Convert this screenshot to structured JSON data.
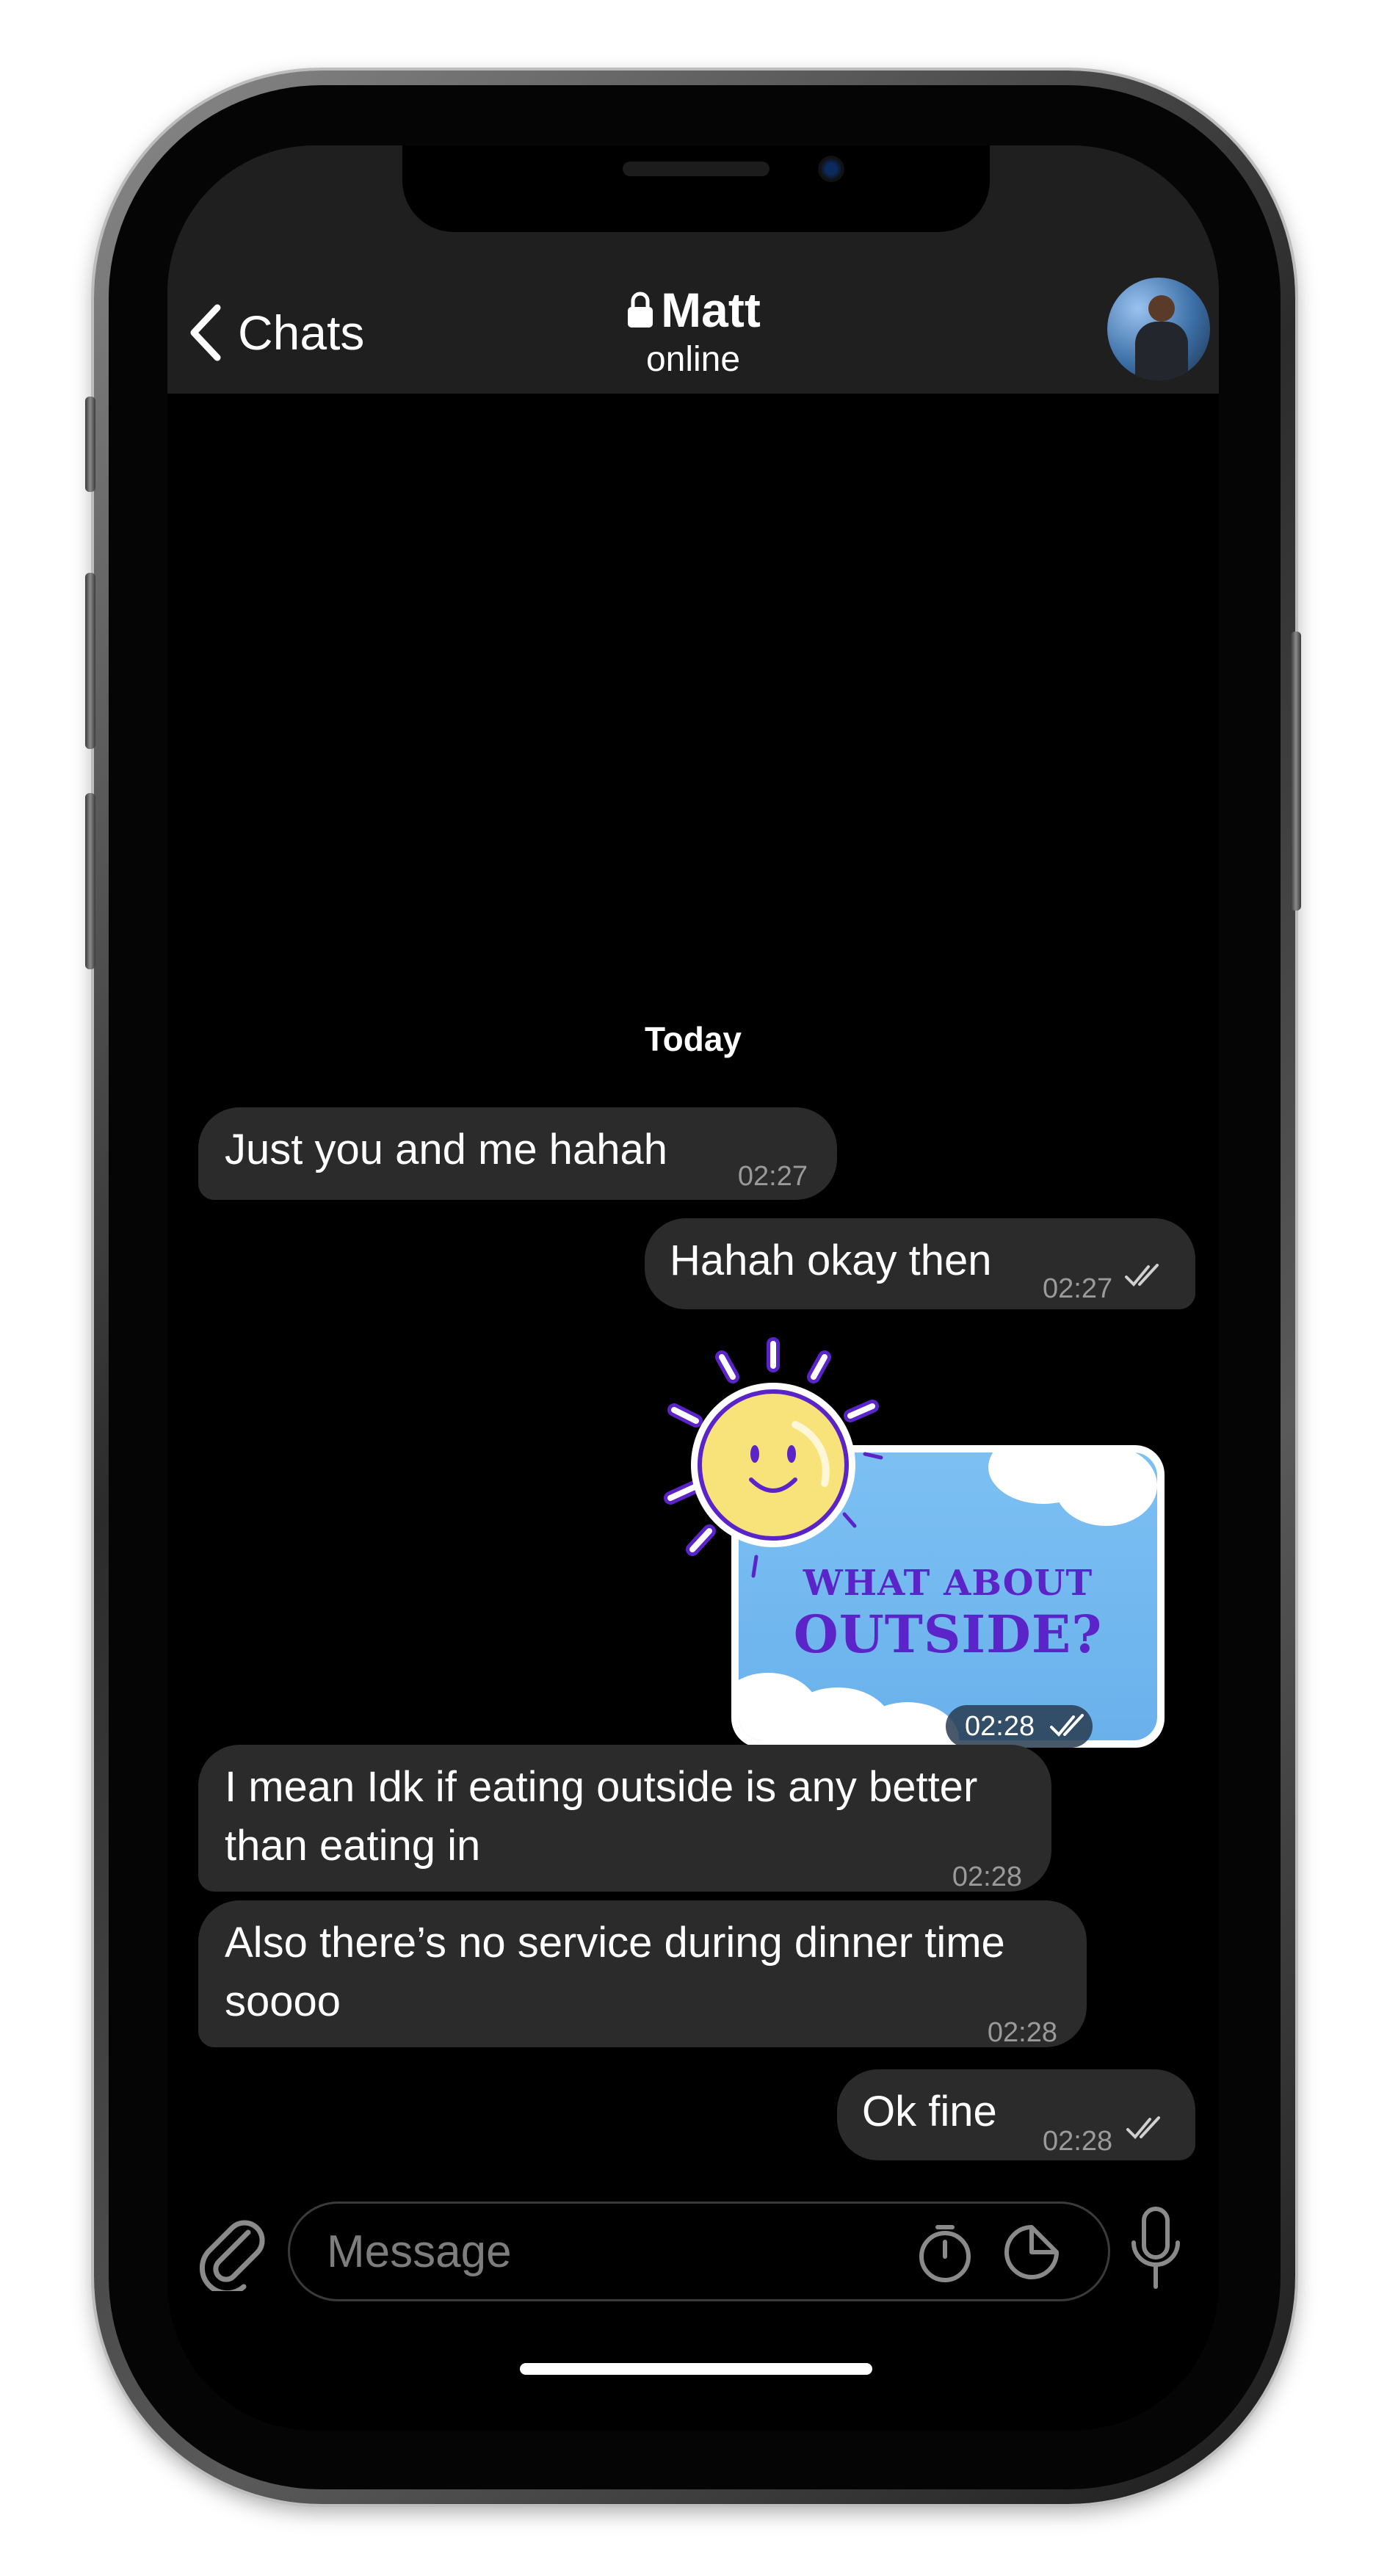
{
  "header": {
    "back_label": "Chats",
    "contact_name": "Matt",
    "status": "online"
  },
  "chat": {
    "date_divider": "Today",
    "messages": [
      {
        "direction": "incoming",
        "text": "Just you and me hahah",
        "time": "02:27"
      },
      {
        "direction": "outgoing",
        "text": "Hahah okay then",
        "time": "02:27"
      },
      {
        "direction": "outgoing",
        "type": "sticker",
        "sticker_line1": "WHAT ABOUT",
        "sticker_line2": "OUTSIDE?",
        "time": "02:28"
      },
      {
        "direction": "incoming",
        "text": "I mean Idk if eating outside is any better than eating in",
        "time": "02:28"
      },
      {
        "direction": "incoming",
        "text": "Also there’s no service during dinner time soooo",
        "time": "02:28"
      },
      {
        "direction": "outgoing",
        "text": "Ok fine",
        "time": "02:28"
      }
    ]
  },
  "composer": {
    "placeholder": "Message"
  },
  "colors": {
    "header_bg": "#1f1f1f",
    "bubble_bg": "#2b2b2b",
    "sticker_text": "#5b24c8",
    "sky": "#7cc0f3",
    "sun": "#f8e27a"
  },
  "icons": [
    "chevron-left-icon",
    "lock-icon",
    "read-checks-icon",
    "paperclip-icon",
    "timer-icon",
    "sticker-icon",
    "microphone-icon"
  ]
}
